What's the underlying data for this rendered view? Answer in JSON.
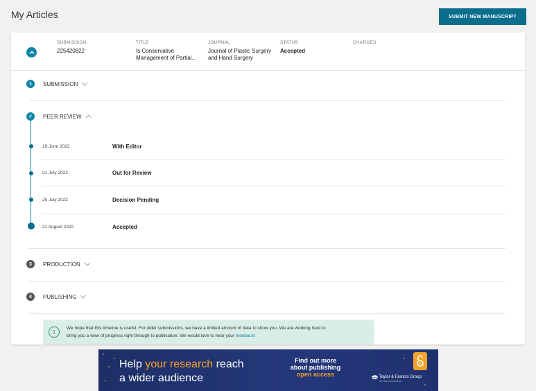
{
  "page": {
    "title": "My Articles"
  },
  "actions": {
    "submit_label": "SUBMIT NEW MANUSCRIPT"
  },
  "summary": {
    "submission_label": "SUBMISSION",
    "submission_value": "225420822",
    "title_label": "TITLE",
    "title_value_1": "Is Conservative",
    "title_value_2": "Management of Partial...",
    "journal_label": "JOURNAL",
    "journal_value_1": "Journal of Plastic Surgery",
    "journal_value_2": "and Hand Surgery",
    "status_label": "STATUS",
    "status_value": "Accepted",
    "charges_label": "CHARGES"
  },
  "steps": [
    {
      "num": "1",
      "label": "SUBMISSION"
    },
    {
      "num": "✓",
      "label": "PEER REVIEW"
    },
    {
      "num": "3",
      "label": "PRODUCTION"
    },
    {
      "num": "4",
      "label": "PUBLISHING"
    }
  ],
  "timeline": [
    {
      "date": "19 June 2022",
      "status": "With Editor"
    },
    {
      "date": "01 July 2022",
      "status": "Out for Review"
    },
    {
      "date": "25 July 2022",
      "status": "Decision Pending"
    },
    {
      "date": "21 August 2022",
      "status": "Accepted"
    }
  ],
  "notice": {
    "icon": "1",
    "text_1": "We hope that this timeline is useful. For older submissions, we have a limited amount of data to show you. We are working hard to",
    "text_2": "bring you a view of progress right through to publication. We would love to hear your",
    "link": "feedback",
    "end": "!"
  },
  "banner": {
    "line1_a": "Help",
    "line1_hl": "your research",
    "line1_b": "reach",
    "line2": "a wider audience",
    "mid_1": "Find out more",
    "mid_2": "about publishing",
    "mid_3": "open access",
    "logo": "Taylor & Francis Group",
    "logo_sub": "an informa business"
  },
  "colors": {
    "accent": "#0a6e8c",
    "link": "#1285a8",
    "notice_bg": "#d9eee6",
    "banner_highlight": "#f3a32a"
  }
}
